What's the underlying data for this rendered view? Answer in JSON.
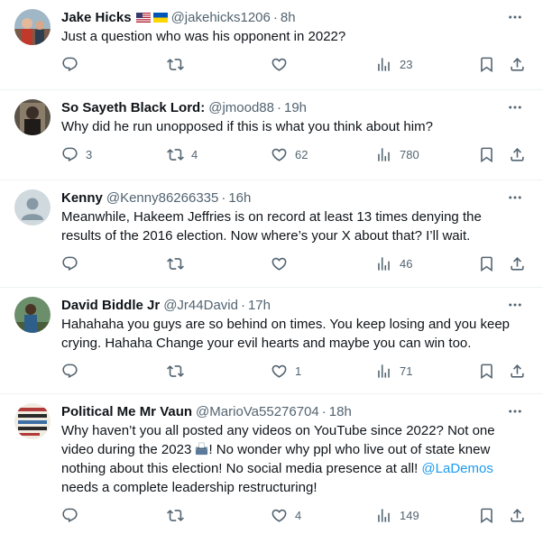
{
  "tweets": [
    {
      "name": "Jake Hicks",
      "flags": [
        "us-flag-icon",
        "ukraine-flag-icon"
      ],
      "handle": "@jakehicks1206",
      "dot": "·",
      "time": "8h",
      "lines": [
        "Just a question who was his opponent in 2022?"
      ],
      "replies": "",
      "retweets": "",
      "likes": "",
      "views": "23"
    },
    {
      "name": "So Sayeth Black Lord:",
      "handle": "@jmood88",
      "dot": "·",
      "time": "19h",
      "lines": [
        "Why did he run unopposed if this is what you think about him?"
      ],
      "replies": "3",
      "retweets": "4",
      "likes": "62",
      "views": "780"
    },
    {
      "name": "Kenny",
      "handle": "@Kenny86266335",
      "dot": "·",
      "time": "16h",
      "lines": [
        "Meanwhile, Hakeem Jeffries is on record at least 13 times denying the",
        "results of the 2016 election. Now where’s your X about that? I’ll wait."
      ],
      "replies": "",
      "retweets": "",
      "likes": "",
      "views": "46"
    },
    {
      "name": "David Biddle Jr",
      "handle": "@Jr44David",
      "dot": "·",
      "time": "17h",
      "lines": [
        "Hahahaha you guys are so behind on times. You keep losing and you keep",
        "crying. Hahaha Change your evil hearts and maybe you can win too."
      ],
      "replies": "",
      "retweets": "",
      "likes": "1",
      "views": "71"
    },
    {
      "name": "Political Me Mr Vaun",
      "handle": "@MarioVa55276704",
      "dot": "·",
      "time": "18h",
      "line1": "Why haven’t you all posted any videos on YouTube since 2022? Not one",
      "line2a": "video during the 2023 ",
      "line2b": "! No wonder why ppl who live out of state knew",
      "line3a": "nothing about this election! No social media presence at all! ",
      "mention": "@LaDemos",
      "line4": "needs a complete leadership restructuring!",
      "ballot_icon": "ballot-box-icon",
      "replies": "",
      "retweets": "",
      "likes": "4",
      "views": "149"
    }
  ],
  "colors": {
    "text": "#0f1419",
    "muted": "#536471",
    "link": "#1d9bf0",
    "divider": "#eff3f4"
  }
}
